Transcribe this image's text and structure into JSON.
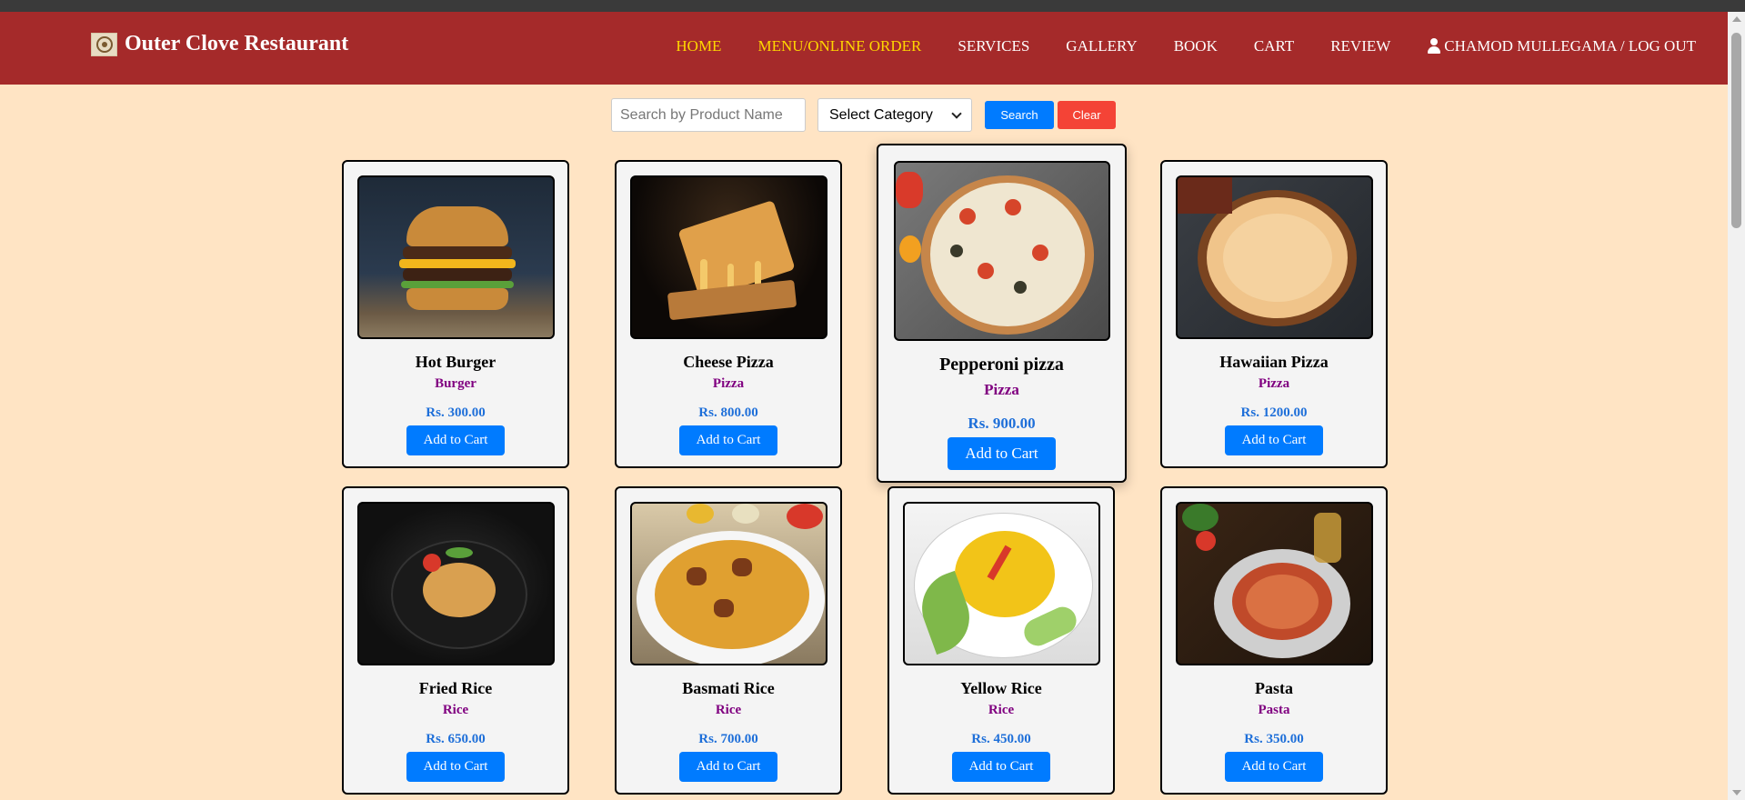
{
  "navbar": {
    "brand": "Outer Clove Restaurant",
    "links": [
      {
        "label": "HOME",
        "active": true
      },
      {
        "label": "MENU/ONLINE ORDER",
        "active": true
      },
      {
        "label": "SERVICES",
        "active": false
      },
      {
        "label": "GALLERY",
        "active": false
      },
      {
        "label": "BOOK",
        "active": false
      },
      {
        "label": "CART",
        "active": false
      },
      {
        "label": "REVIEW",
        "active": false
      }
    ],
    "user_label": "CHAMOD MULLEGAMA / LOG OUT"
  },
  "search": {
    "placeholder": "Search by Product Name",
    "category_selected": "Select Category",
    "search_label": "Search",
    "clear_label": "Clear"
  },
  "products": [
    {
      "name": "Hot Burger",
      "category": "Burger",
      "price": "Rs. 300.00",
      "button": "Add to Cart"
    },
    {
      "name": "Cheese Pizza",
      "category": "Pizza",
      "price": "Rs. 800.00",
      "button": "Add to Cart"
    },
    {
      "name": "Pepperoni pizza",
      "category": "Pizza",
      "price": "Rs. 900.00",
      "button": "Add to Cart"
    },
    {
      "name": "Hawaiian Pizza",
      "category": "Pizza",
      "price": "Rs. 1200.00",
      "button": "Add to Cart"
    },
    {
      "name": "Fried Rice",
      "category": "Rice",
      "price": "Rs. 650.00",
      "button": "Add to Cart"
    },
    {
      "name": "Basmati Rice",
      "category": "Rice",
      "price": "Rs. 700.00",
      "button": "Add to Cart"
    },
    {
      "name": "Yellow Rice",
      "category": "Rice",
      "price": "Rs. 450.00",
      "button": "Add to Cart"
    },
    {
      "name": "Pasta",
      "category": "Pasta",
      "price": "Rs. 350.00",
      "button": "Add to Cart"
    }
  ],
  "colors": {
    "navbar": "#a52a2a",
    "page_bg": "#ffe4c4",
    "active_link": "#ffd700",
    "button_blue": "#007bff",
    "button_red": "#f44336",
    "category_text": "#800080",
    "price_text": "#1e6fd9"
  }
}
